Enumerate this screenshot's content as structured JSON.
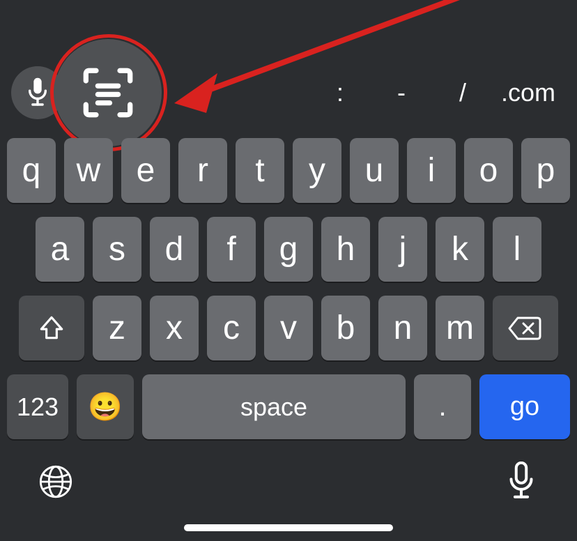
{
  "annotation": {
    "color": "#d9221f"
  },
  "toolbar": {
    "mic_icon": "microphone-icon",
    "scan_icon": "scan-text-icon",
    "shortcuts": [
      ":",
      "-",
      "/",
      ".com"
    ]
  },
  "keyboard": {
    "row1": [
      "q",
      "w",
      "e",
      "r",
      "t",
      "y",
      "u",
      "i",
      "o",
      "p"
    ],
    "row2": [
      "a",
      "s",
      "d",
      "f",
      "g",
      "h",
      "j",
      "k",
      "l"
    ],
    "row3_letters": [
      "z",
      "x",
      "c",
      "v",
      "b",
      "n",
      "m"
    ],
    "shift_icon": "shift-icon",
    "backspace_icon": "backspace-icon",
    "numbers_label": "123",
    "emoji_label": "😀",
    "space_label": "space",
    "period_label": ".",
    "go_label": "go"
  },
  "bottombar": {
    "globe_icon": "globe-icon",
    "dictation_icon": "microphone-icon"
  }
}
